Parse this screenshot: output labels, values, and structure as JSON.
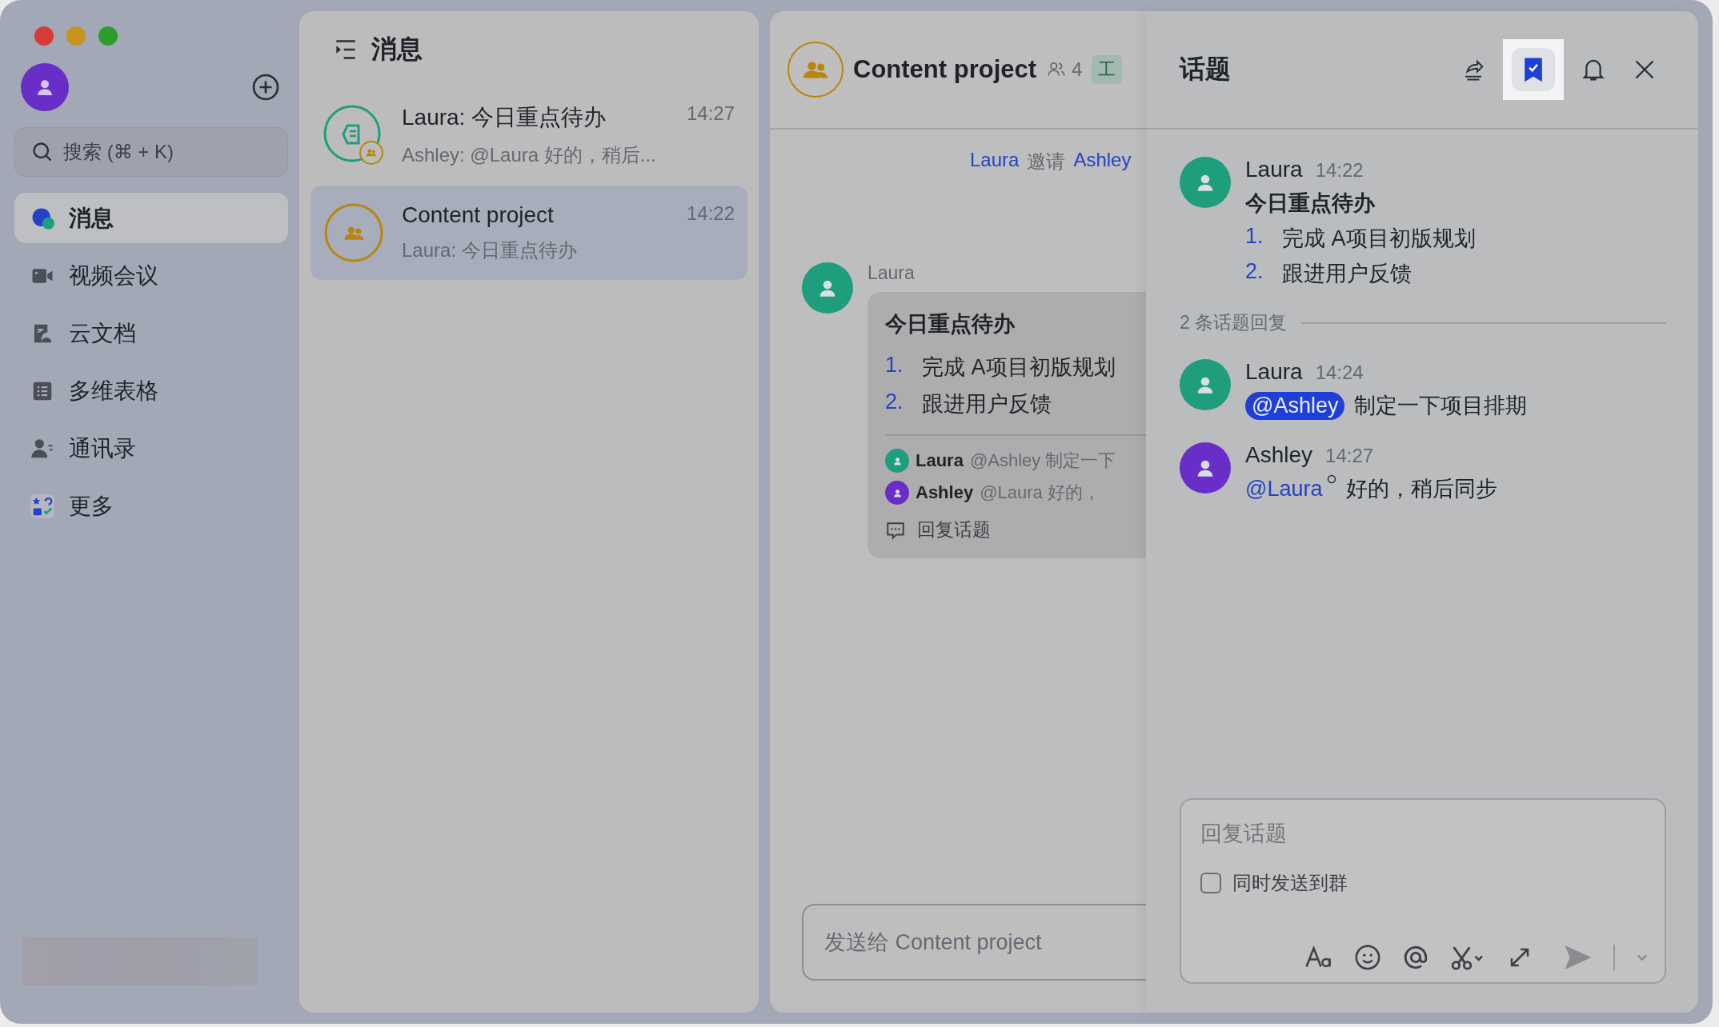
{
  "sidebar": {
    "search": {
      "placeholder": "搜索 (⌘ + K)"
    },
    "items": [
      {
        "label": "消息",
        "kind": "messages",
        "selected": true
      },
      {
        "label": "视频会议",
        "kind": "video",
        "selected": false
      },
      {
        "label": "云文档",
        "kind": "docs",
        "selected": false
      },
      {
        "label": "多维表格",
        "kind": "table",
        "selected": false
      },
      {
        "label": "通讯录",
        "kind": "contacts",
        "selected": false
      },
      {
        "label": "更多",
        "kind": "more",
        "selected": false
      }
    ]
  },
  "chat_list": {
    "title": "消息",
    "items": [
      {
        "title": "Laura: 今日重点待办",
        "time": "14:27",
        "preview": "Ashley: @Laura 好的，稍后...",
        "kind": "topic",
        "selected": false
      },
      {
        "title": "Content project",
        "time": "14:22",
        "preview": "Laura: 今日重点待办",
        "kind": "group",
        "selected": true
      }
    ]
  },
  "chat": {
    "title": "Content project",
    "member_count": "4",
    "tag": "工",
    "system_message": {
      "actor": "Laura",
      "verb": "邀请",
      "target": "Ashley"
    },
    "message": {
      "sender": "Laura",
      "title": "今日重点待办",
      "list": [
        {
          "number": "1.",
          "text": "完成 A项目初版规划"
        },
        {
          "number": "2.",
          "text": "跟进用户反馈"
        }
      ],
      "replies": [
        {
          "sender": "Laura",
          "text": "@Ashley 制定一下",
          "color": "#1f9e7e"
        },
        {
          "sender": "Ashley",
          "text": "@Laura 好的，",
          "color": "#6a2ec8"
        }
      ],
      "reply_action": "回复话题"
    },
    "input": {
      "placeholder": "发送给 Content project"
    }
  },
  "thread": {
    "title": "话题",
    "actions": [
      {
        "kind": "share",
        "selected": false
      },
      {
        "kind": "bookmark",
        "selected": true
      },
      {
        "kind": "bell",
        "selected": false
      },
      {
        "kind": "close",
        "selected": false
      }
    ],
    "root": {
      "sender": "Laura",
      "time": "14:22",
      "title": "今日重点待办",
      "color": "#1f9e7e",
      "list": [
        {
          "number": "1.",
          "text": "完成 A项目初版规划"
        },
        {
          "number": "2.",
          "text": "跟进用户反馈"
        }
      ]
    },
    "reply_count": "2 条话题回复",
    "replies": [
      {
        "sender": "Laura",
        "time": "14:24",
        "mention": "@Ashley",
        "kind": "pill",
        "text": "制定一下项目排期",
        "color": "#1f9e7e"
      },
      {
        "sender": "Ashley",
        "time": "14:27",
        "mention": "@Laura",
        "kind": "link",
        "text": "好的，稍后同步",
        "color": "#6a2ec8"
      }
    ],
    "composer": {
      "placeholder": "回复话题",
      "also_send": {
        "label": "同时发送到群",
        "checked": false
      }
    }
  }
}
